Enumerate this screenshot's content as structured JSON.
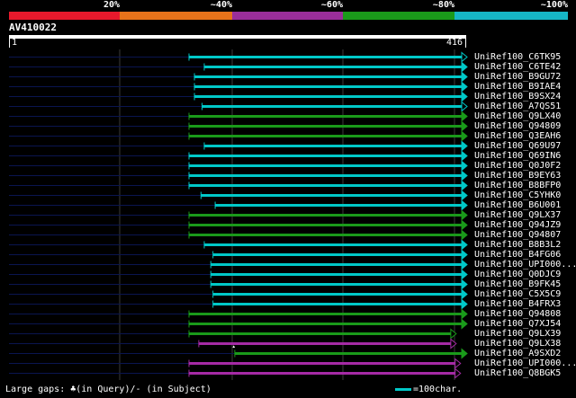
{
  "legend": {
    "labels": [
      "20%",
      "~40%",
      "~60%",
      "~80%",
      "~100%"
    ],
    "colors": [
      "#e8192c",
      "#e8731a",
      "#9a2e9a",
      "#1a9a1a",
      "#16b6c6"
    ]
  },
  "query": {
    "name": "AV410022",
    "start_label": "1",
    "end_label": "416",
    "length": 416
  },
  "hits": [
    {
      "name": "UniRef100_C6TK95",
      "start": 166,
      "end": 416,
      "color": "cyan",
      "arrow": true
    },
    {
      "name": "UniRef100_C6TE42",
      "start": 180,
      "end": 416,
      "color": "cyan",
      "arrow": false
    },
    {
      "name": "UniRef100_B9GU72",
      "start": 171,
      "end": 416,
      "color": "cyan",
      "arrow": false
    },
    {
      "name": "UniRef100_B9IAE4",
      "start": 171,
      "end": 416,
      "color": "cyan",
      "arrow": false
    },
    {
      "name": "UniRef100_B9SX24",
      "start": 171,
      "end": 416,
      "color": "cyan",
      "arrow": false
    },
    {
      "name": "UniRef100_A7QS51",
      "start": 178,
      "end": 416,
      "color": "cyan",
      "arrow": true
    },
    {
      "name": "UniRef100_Q9LX40",
      "start": 166,
      "end": 416,
      "color": "green",
      "arrow": false
    },
    {
      "name": "UniRef100_Q94809",
      "start": 166,
      "end": 416,
      "color": "green",
      "arrow": false
    },
    {
      "name": "UniRef100_Q3EAH6",
      "start": 166,
      "end": 416,
      "color": "green",
      "arrow": false
    },
    {
      "name": "UniRef100_Q69U97",
      "start": 180,
      "end": 416,
      "color": "cyan",
      "arrow": false
    },
    {
      "name": "UniRef100_Q69IN6",
      "start": 166,
      "end": 416,
      "color": "cyan",
      "arrow": false
    },
    {
      "name": "UniRef100_Q0J0F2",
      "start": 166,
      "end": 416,
      "color": "cyan",
      "arrow": false
    },
    {
      "name": "UniRef100_B9EY63",
      "start": 166,
      "end": 416,
      "color": "cyan",
      "arrow": false
    },
    {
      "name": "UniRef100_B8BFP0",
      "start": 166,
      "end": 416,
      "color": "cyan",
      "arrow": false
    },
    {
      "name": "UniRef100_C5YHK0",
      "start": 177,
      "end": 416,
      "color": "cyan",
      "arrow": false
    },
    {
      "name": "UniRef100_B6U001",
      "start": 190,
      "end": 416,
      "color": "cyan",
      "arrow": false
    },
    {
      "name": "UniRef100_Q9LX37",
      "start": 166,
      "end": 416,
      "color": "green",
      "arrow": false
    },
    {
      "name": "UniRef100_Q94JZ9",
      "start": 166,
      "end": 416,
      "color": "green",
      "arrow": false
    },
    {
      "name": "UniRef100_Q94807",
      "start": 166,
      "end": 416,
      "color": "green",
      "arrow": false
    },
    {
      "name": "UniRef100_B8B3L2",
      "start": 180,
      "end": 416,
      "color": "cyan",
      "arrow": false
    },
    {
      "name": "UniRef100_B4FG06",
      "start": 188,
      "end": 416,
      "color": "cyan",
      "arrow": false
    },
    {
      "name": "UniRef100_UPI000...",
      "start": 186,
      "end": 416,
      "color": "cyan",
      "arrow": false
    },
    {
      "name": "UniRef100_Q0DJC9",
      "start": 186,
      "end": 416,
      "color": "cyan",
      "arrow": false
    },
    {
      "name": "UniRef100_B9FK45",
      "start": 186,
      "end": 416,
      "color": "cyan",
      "arrow": false
    },
    {
      "name": "UniRef100_C5X5C9",
      "start": 188,
      "end": 416,
      "color": "cyan",
      "arrow": false
    },
    {
      "name": "UniRef100_B4FRX3",
      "start": 188,
      "end": 416,
      "color": "cyan",
      "arrow": false
    },
    {
      "name": "UniRef100_Q94808",
      "start": 166,
      "end": 416,
      "color": "green",
      "arrow": false
    },
    {
      "name": "UniRef100_Q7XJ54",
      "start": 166,
      "end": 416,
      "color": "green",
      "arrow": false
    },
    {
      "name": "UniRef100_Q9LX39",
      "start": 166,
      "end": 406,
      "color": "green",
      "arrow": true
    },
    {
      "name": "UniRef100_Q9LX38",
      "start": 175,
      "end": 406,
      "color": "purple",
      "arrow": true,
      "gap_at": 207
    },
    {
      "name": "UniRef100_A9SXD2",
      "start": 208,
      "end": 416,
      "color": "green",
      "arrow": false
    },
    {
      "name": "UniRef100_UPI000...",
      "start": 166,
      "end": 410,
      "color": "purple",
      "arrow": true
    },
    {
      "name": "UniRef100_Q8BGK5",
      "start": 166,
      "end": 410,
      "color": "purple",
      "arrow": true
    }
  ],
  "footer": {
    "gaps_label": "Large gaps:",
    "gaps_query": "(in Query)/-",
    "gaps_subject": "(in Subject)",
    "gap_glyph": "♣",
    "scale_label": "=100char."
  },
  "colors": {
    "cyan": "#00c8c8",
    "green": "#1a9a1a",
    "purple": "#a52aa5",
    "navy": "#0a1550",
    "grid": "#3a3a3a"
  }
}
